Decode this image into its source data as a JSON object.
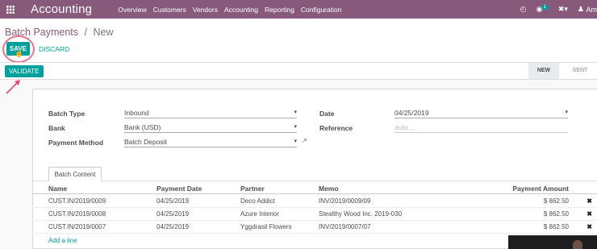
{
  "navbar": {
    "app_name": "Accounting",
    "menu": [
      "Overview",
      "Customers",
      "Vendors",
      "Accounting",
      "Reporting",
      "Configuration"
    ],
    "messages_count": "1",
    "user_name": "Am"
  },
  "breadcrumb": {
    "parent": "Batch Payments",
    "separator": "/",
    "current": "New"
  },
  "buttons": {
    "save": "SAVE",
    "discard": "DISCARD",
    "validate": "VALIDATE"
  },
  "status_stages": [
    "NEW",
    "SENT"
  ],
  "form": {
    "batch_type_label": "Batch Type",
    "batch_type_value": "Inbound",
    "bank_label": "Bank",
    "bank_value": "Bank (USD)",
    "payment_method_label": "Payment Method",
    "payment_method_value": "Batch Deposit",
    "date_label": "Date",
    "date_value": "04/25/2019",
    "reference_label": "Reference",
    "reference_placeholder": "auto ..."
  },
  "tab": "Batch Content",
  "table": {
    "headers": [
      "Name",
      "Payment Date",
      "Partner",
      "Memo",
      "Payment Amount"
    ],
    "rows": [
      [
        "CUST.IN/2019/0009",
        "04/25/2019",
        "Deco Addict",
        "INV/2019/0009/09",
        "$ 862.50"
      ],
      [
        "CUST.IN/2019/0008",
        "04/25/2019",
        "Azure Interior",
        "Stealthy Wood Inc. 2019-030",
        "$ 862.50"
      ],
      [
        "CUST.IN/2019/0007",
        "04/25/2019",
        "Yggdrasil Flowers",
        "INV/2019/0007/07",
        "$ 862.50"
      ]
    ],
    "add_line": "Add a line"
  }
}
